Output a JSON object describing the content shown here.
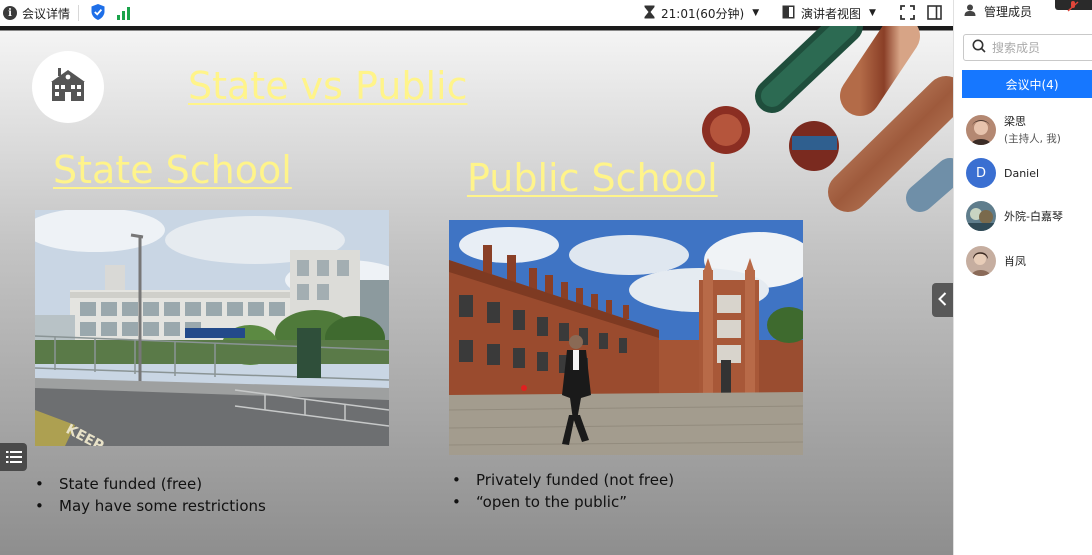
{
  "toolbar": {
    "meeting_info_label": "会议详情",
    "timer": "21:01(60分钟)",
    "view_mode_label": "演讲者视图"
  },
  "sidebar": {
    "title": "管理成员",
    "search_placeholder": "搜索成员",
    "status_tab_label": "会议中(4)",
    "members": [
      {
        "name": "梁思",
        "role": "(主持人, 我)"
      },
      {
        "name": "Daniel",
        "initial": "D"
      },
      {
        "name": "外院-白嘉琴"
      },
      {
        "name": "肖凤"
      }
    ]
  },
  "slide": {
    "title": "State vs Public",
    "left": {
      "heading": "State School",
      "bullets": [
        "State funded (free)",
        "May have some restrictions"
      ]
    },
    "right": {
      "heading": "Public School",
      "bullets": [
        "Privately funded (not free)",
        "“open to the public”"
      ]
    }
  },
  "colors": {
    "accent_blue": "#1677ff",
    "title_yellow": "#fff48a",
    "signal_green": "#1aa34a",
    "shield_blue": "#1e6fe8"
  },
  "icons": [
    "info-icon",
    "shield-icon",
    "signal-icon",
    "hourglass-icon",
    "presenter-view-icon",
    "fullscreen-icon",
    "sidebar-toggle-icon",
    "person-icon",
    "search-icon",
    "school-icon",
    "list-menu-icon",
    "chevron-left-icon"
  ]
}
